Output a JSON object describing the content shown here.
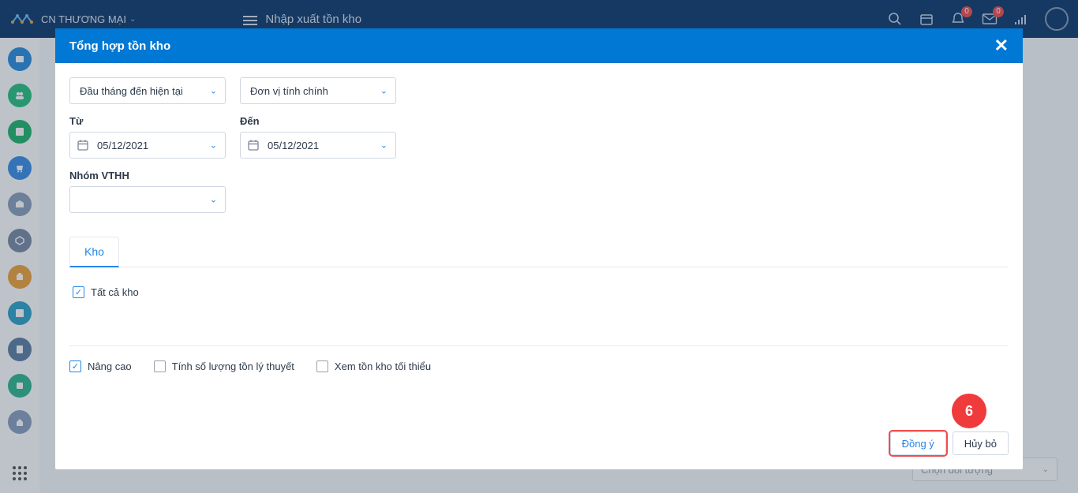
{
  "topbar": {
    "branch": "CN THƯƠNG MẠI",
    "page_title": "Nhập xuất tồn kho",
    "badge_bell": "0",
    "badge_mail": "0"
  },
  "behind": {
    "dropdown_text": "Chọn đối tượng"
  },
  "modal": {
    "title": "Tổng hợp tồn kho",
    "period_select": "Đầu tháng đến hiện tại",
    "unit_select": "Đơn vị tính chính",
    "from_label": "Từ",
    "to_label": "Đến",
    "from_value": "05/12/2021",
    "to_value": "05/12/2021",
    "group_label": "Nhóm VTHH",
    "tab_label": "Kho",
    "chk_all": "Tất cả kho",
    "chk_adv": "Nâng cao",
    "chk_theory": "Tính số lượng tồn lý thuyết",
    "chk_min": "Xem tồn kho tối thiểu",
    "btn_ok": "Đồng ý",
    "btn_cancel": "Hủy bỏ"
  },
  "annotation": {
    "step": "6"
  },
  "sidebar": {
    "colors": [
      "#2a8de0",
      "#29c07f",
      "#20b56d",
      "#3b8de8",
      "#8ca0bb",
      "#7a8aa5",
      "#f0a23c",
      "#2ea3c7",
      "#5c7fa5",
      "#2fb78f",
      "#8aa0c0"
    ]
  }
}
